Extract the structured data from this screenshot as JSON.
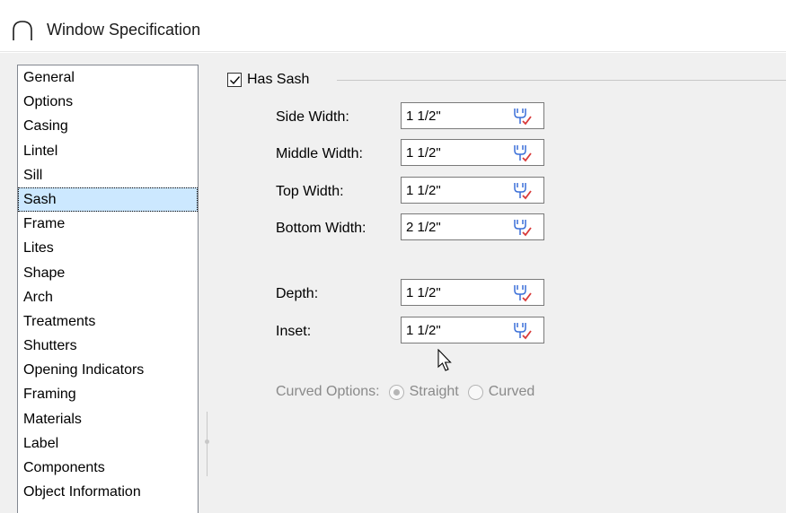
{
  "window": {
    "title": "Window Specification",
    "icon": "arch-window-icon"
  },
  "sidebar": {
    "selected": "Sash",
    "items": [
      {
        "label": "General"
      },
      {
        "label": "Options"
      },
      {
        "label": "Casing"
      },
      {
        "label": "Lintel"
      },
      {
        "label": "Sill"
      },
      {
        "label": "Sash"
      },
      {
        "label": "Frame"
      },
      {
        "label": "Lites"
      },
      {
        "label": "Shape"
      },
      {
        "label": "Arch"
      },
      {
        "label": "Treatments"
      },
      {
        "label": "Shutters"
      },
      {
        "label": "Opening Indicators"
      },
      {
        "label": "Framing"
      },
      {
        "label": "Materials"
      },
      {
        "label": "Label"
      },
      {
        "label": "Components"
      },
      {
        "label": "Object Information"
      }
    ]
  },
  "sash": {
    "has_sash_label": "Has Sash",
    "has_sash_checked": true,
    "fields": [
      {
        "label": "Side Width:",
        "value": "1 1/2\""
      },
      {
        "label": "Middle Width:",
        "value": "1 1/2\""
      },
      {
        "label": "Top Width:",
        "value": "1 1/2\""
      },
      {
        "label": "Bottom Width:",
        "value": "2 1/2\""
      },
      {
        "label": "Depth:",
        "value": "1 1/2\""
      },
      {
        "label": "Inset:",
        "value": "1 1/2\""
      }
    ],
    "curved_options": {
      "label": "Curved Options:",
      "options": [
        "Straight",
        "Curved"
      ],
      "selected": "Straight",
      "disabled": true
    }
  },
  "colors": {
    "selection": "#cce8ff",
    "dialog_bg": "#f0f0f0",
    "icon_blue": "#3a6fd8",
    "icon_red": "#d83a3a"
  }
}
